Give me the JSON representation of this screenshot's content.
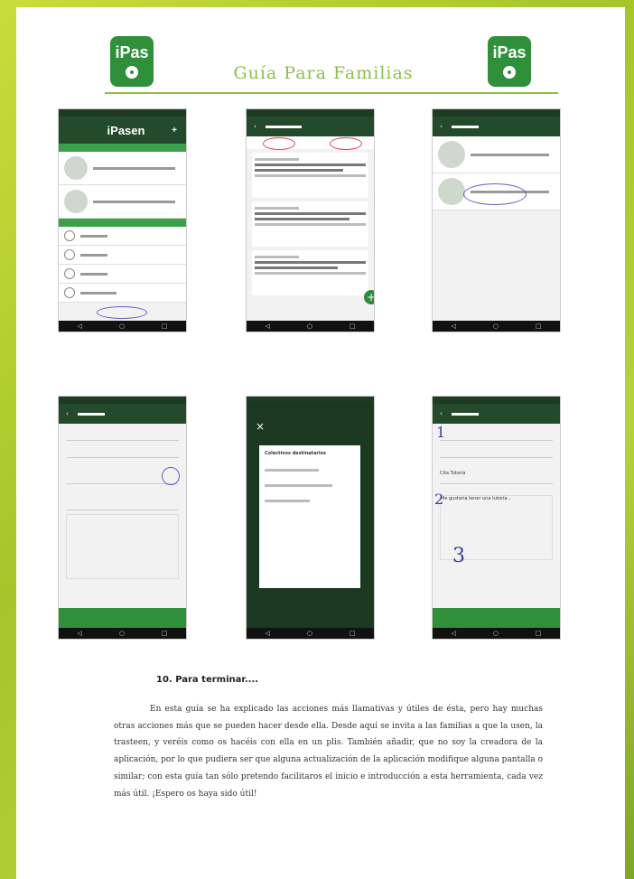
{
  "header": {
    "logo_text": "iPas",
    "title": "Guía Para Familias"
  },
  "phones": {
    "p1_title": "iPasen",
    "p1_plus": "+",
    "p2_back": "‹",
    "p4_close": "×",
    "p4_dialog_title": "Colectivos destinatarios",
    "p5_num1": "1",
    "p5_num2": "2",
    "p5_num3": "3",
    "p5_subject": "Cita Tutoría",
    "p5_message": "Me gustaría tener una tutoría..."
  },
  "section": {
    "title": "10. Para terminar....",
    "body": "En esta guía se ha explicado las acciones más llamativas y útiles de ésta, pero hay muchas otras acciones más que se pueden hacer desde ella. Desde aquí se invita a las familias a que la usen, la trasteen, y veréis como os hacéis con ella en un plis. También añadir, que no soy la creadora de la aplicación, por lo que pudiera ser que alguna actualización de la aplicación modifique alguna pantalla o similar; con esta guía tan sólo pretendo facilitaros el inicio e introducción a esta herramienta, cada vez más útil. ¡Espero os haya sido útil!"
  },
  "colors": {
    "bg_green": "#b7d13a",
    "accent_green": "#8cc04a",
    "app_dark": "#234a2a",
    "app_green": "#3aa04a"
  }
}
